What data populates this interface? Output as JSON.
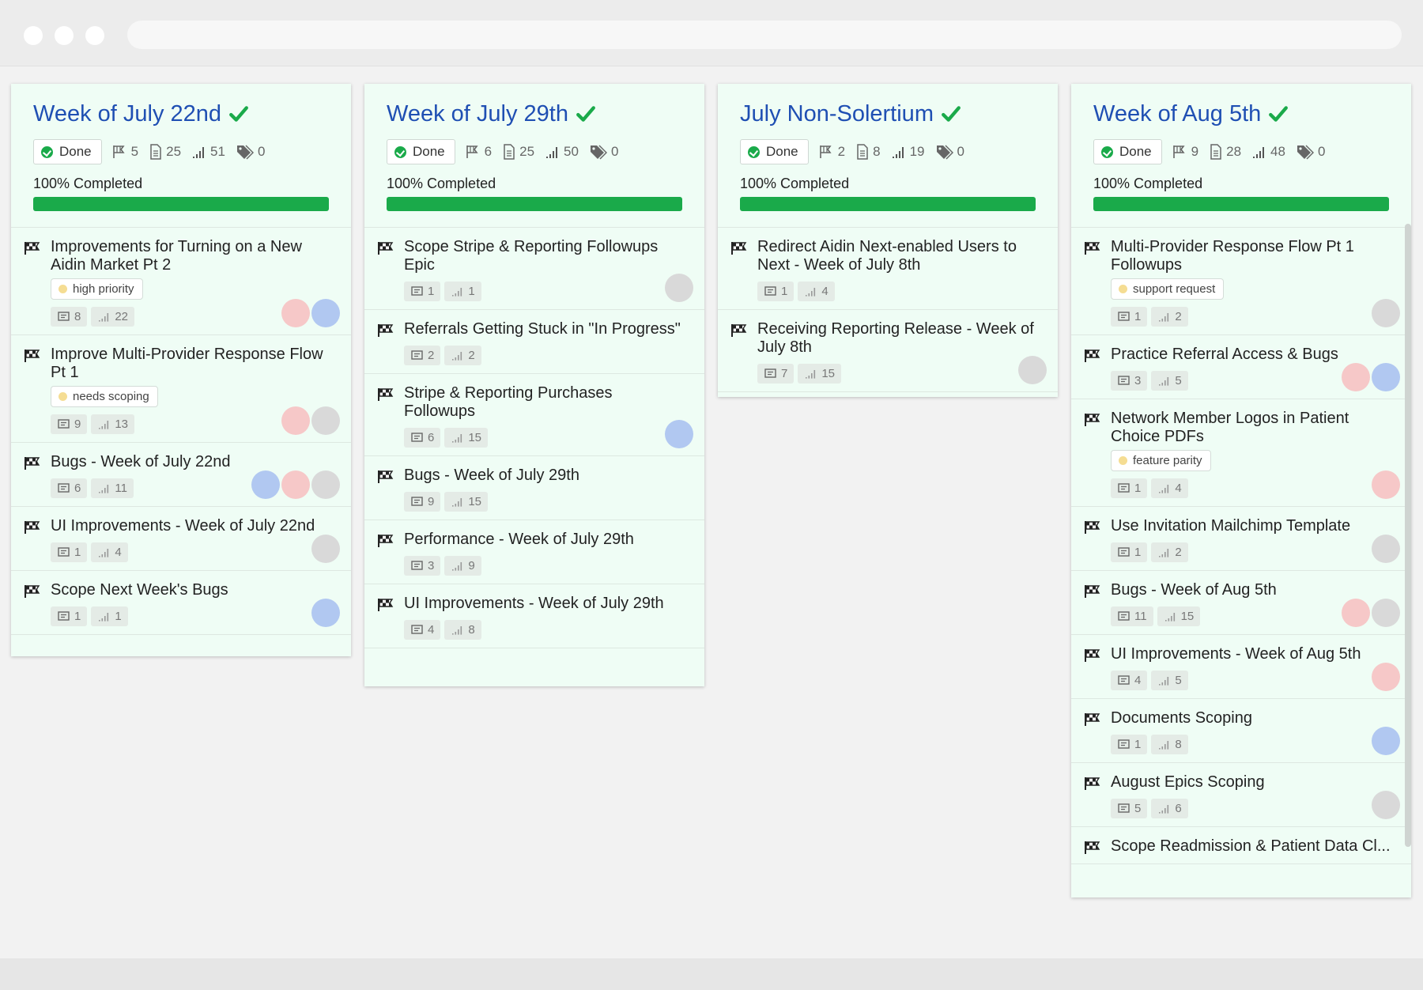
{
  "columns": [
    {
      "title": "Week of July 22nd",
      "status": "Done",
      "milestones": "5",
      "docs": "25",
      "points": "51",
      "tags": "0",
      "progress_label": "100% Completed",
      "progress": 1.0,
      "cards": [
        {
          "title": "Improvements for Turning on a New Aidin Market Pt 2",
          "label": "high priority",
          "docs": "8",
          "points": "22",
          "avatars": [
            "red",
            "blue"
          ]
        },
        {
          "title": "Improve Multi-Provider Response Flow Pt 1",
          "label": "needs scoping",
          "docs": "9",
          "points": "13",
          "avatars": [
            "red",
            "gray"
          ]
        },
        {
          "title": "Bugs - Week of July 22nd",
          "label": "",
          "docs": "6",
          "points": "11",
          "avatars": [
            "blue",
            "red",
            "gray"
          ]
        },
        {
          "title": "UI Improvements - Week of July 22nd",
          "label": "",
          "docs": "1",
          "points": "4",
          "avatars": [
            "gray"
          ]
        },
        {
          "title": "Scope Next Week's Bugs",
          "label": "",
          "docs": "1",
          "points": "1",
          "avatars": [
            "blue"
          ]
        }
      ]
    },
    {
      "title": "Week of July 29th",
      "status": "Done",
      "milestones": "6",
      "docs": "25",
      "points": "50",
      "tags": "0",
      "progress_label": "100% Completed",
      "progress": 1.0,
      "cards": [
        {
          "title": "Scope Stripe & Reporting Followups Epic",
          "label": "",
          "docs": "1",
          "points": "1",
          "avatars": [
            "gray"
          ]
        },
        {
          "title": "Referrals Getting Stuck in \"In Progress\"",
          "label": "",
          "docs": "2",
          "points": "2",
          "avatars": []
        },
        {
          "title": "Stripe & Reporting Purchases Followups",
          "label": "",
          "docs": "6",
          "points": "15",
          "avatars": [
            "blue"
          ]
        },
        {
          "title": "Bugs - Week of July 29th",
          "label": "",
          "docs": "9",
          "points": "15",
          "avatars": []
        },
        {
          "title": "Performance - Week of July 29th",
          "label": "",
          "docs": "3",
          "points": "9",
          "avatars": []
        },
        {
          "title": "UI Improvements - Week of July 29th",
          "label": "",
          "docs": "4",
          "points": "8",
          "avatars": []
        }
      ]
    },
    {
      "title": "July Non-Solertium",
      "status": "Done",
      "milestones": "2",
      "docs": "8",
      "points": "19",
      "tags": "0",
      "progress_label": "100% Completed",
      "progress": 1.0,
      "cards": [
        {
          "title": "Redirect Aidin Next-enabled Users to Next - Week of July 8th",
          "label": "",
          "docs": "1",
          "points": "4",
          "avatars": []
        },
        {
          "title": "Receiving Reporting Release - Week of July 8th",
          "label": "",
          "docs": "7",
          "points": "15",
          "avatars": [
            "gray"
          ]
        }
      ]
    },
    {
      "title": "Week of Aug 5th",
      "status": "Done",
      "milestones": "9",
      "docs": "28",
      "points": "48",
      "tags": "0",
      "progress_label": "100% Completed",
      "progress": 1.0,
      "cards": [
        {
          "title": "Multi-Provider Response Flow Pt 1 Followups",
          "label": "support request",
          "docs": "1",
          "points": "2",
          "avatars": [
            "gray"
          ]
        },
        {
          "title": "Practice Referral Access & Bugs",
          "label": "",
          "docs": "3",
          "points": "5",
          "avatars": [
            "red",
            "blue"
          ]
        },
        {
          "title": "Network Member Logos in Patient Choice PDFs",
          "label": "feature parity",
          "docs": "1",
          "points": "4",
          "avatars": [
            "red"
          ]
        },
        {
          "title": "Use Invitation Mailchimp Template",
          "label": "",
          "docs": "1",
          "points": "2",
          "avatars": [
            "gray"
          ]
        },
        {
          "title": "Bugs - Week of Aug 5th",
          "label": "",
          "docs": "11",
          "points": "15",
          "avatars": [
            "red",
            "gray"
          ]
        },
        {
          "title": "UI Improvements - Week of Aug 5th",
          "label": "",
          "docs": "4",
          "points": "5",
          "avatars": [
            "red"
          ]
        },
        {
          "title": "Documents Scoping",
          "label": "",
          "docs": "1",
          "points": "8",
          "avatars": [
            "blue"
          ]
        },
        {
          "title": "August Epics Scoping",
          "label": "",
          "docs": "5",
          "points": "6",
          "avatars": [
            "gray"
          ]
        },
        {
          "title": "Scope Readmission & Patient Data Cl...",
          "label": "",
          "docs": "",
          "points": "",
          "avatars": []
        }
      ]
    }
  ],
  "colors": {
    "title": "#1f4fb3",
    "done_green": "#1aaa4a",
    "column_bg": "#effdf5",
    "avatar_red": "#f6c8c8",
    "avatar_blue": "#b1c8f1",
    "avatar_gray": "#d9d9d9",
    "label_dot": "#f5dd93"
  },
  "icons": {
    "title_check": "check-icon",
    "milestones": "flag-icon",
    "docs": "document-icon",
    "points": "signal-bars-icon",
    "tags": "tag-icon",
    "card": "checkered-flag-icon"
  }
}
